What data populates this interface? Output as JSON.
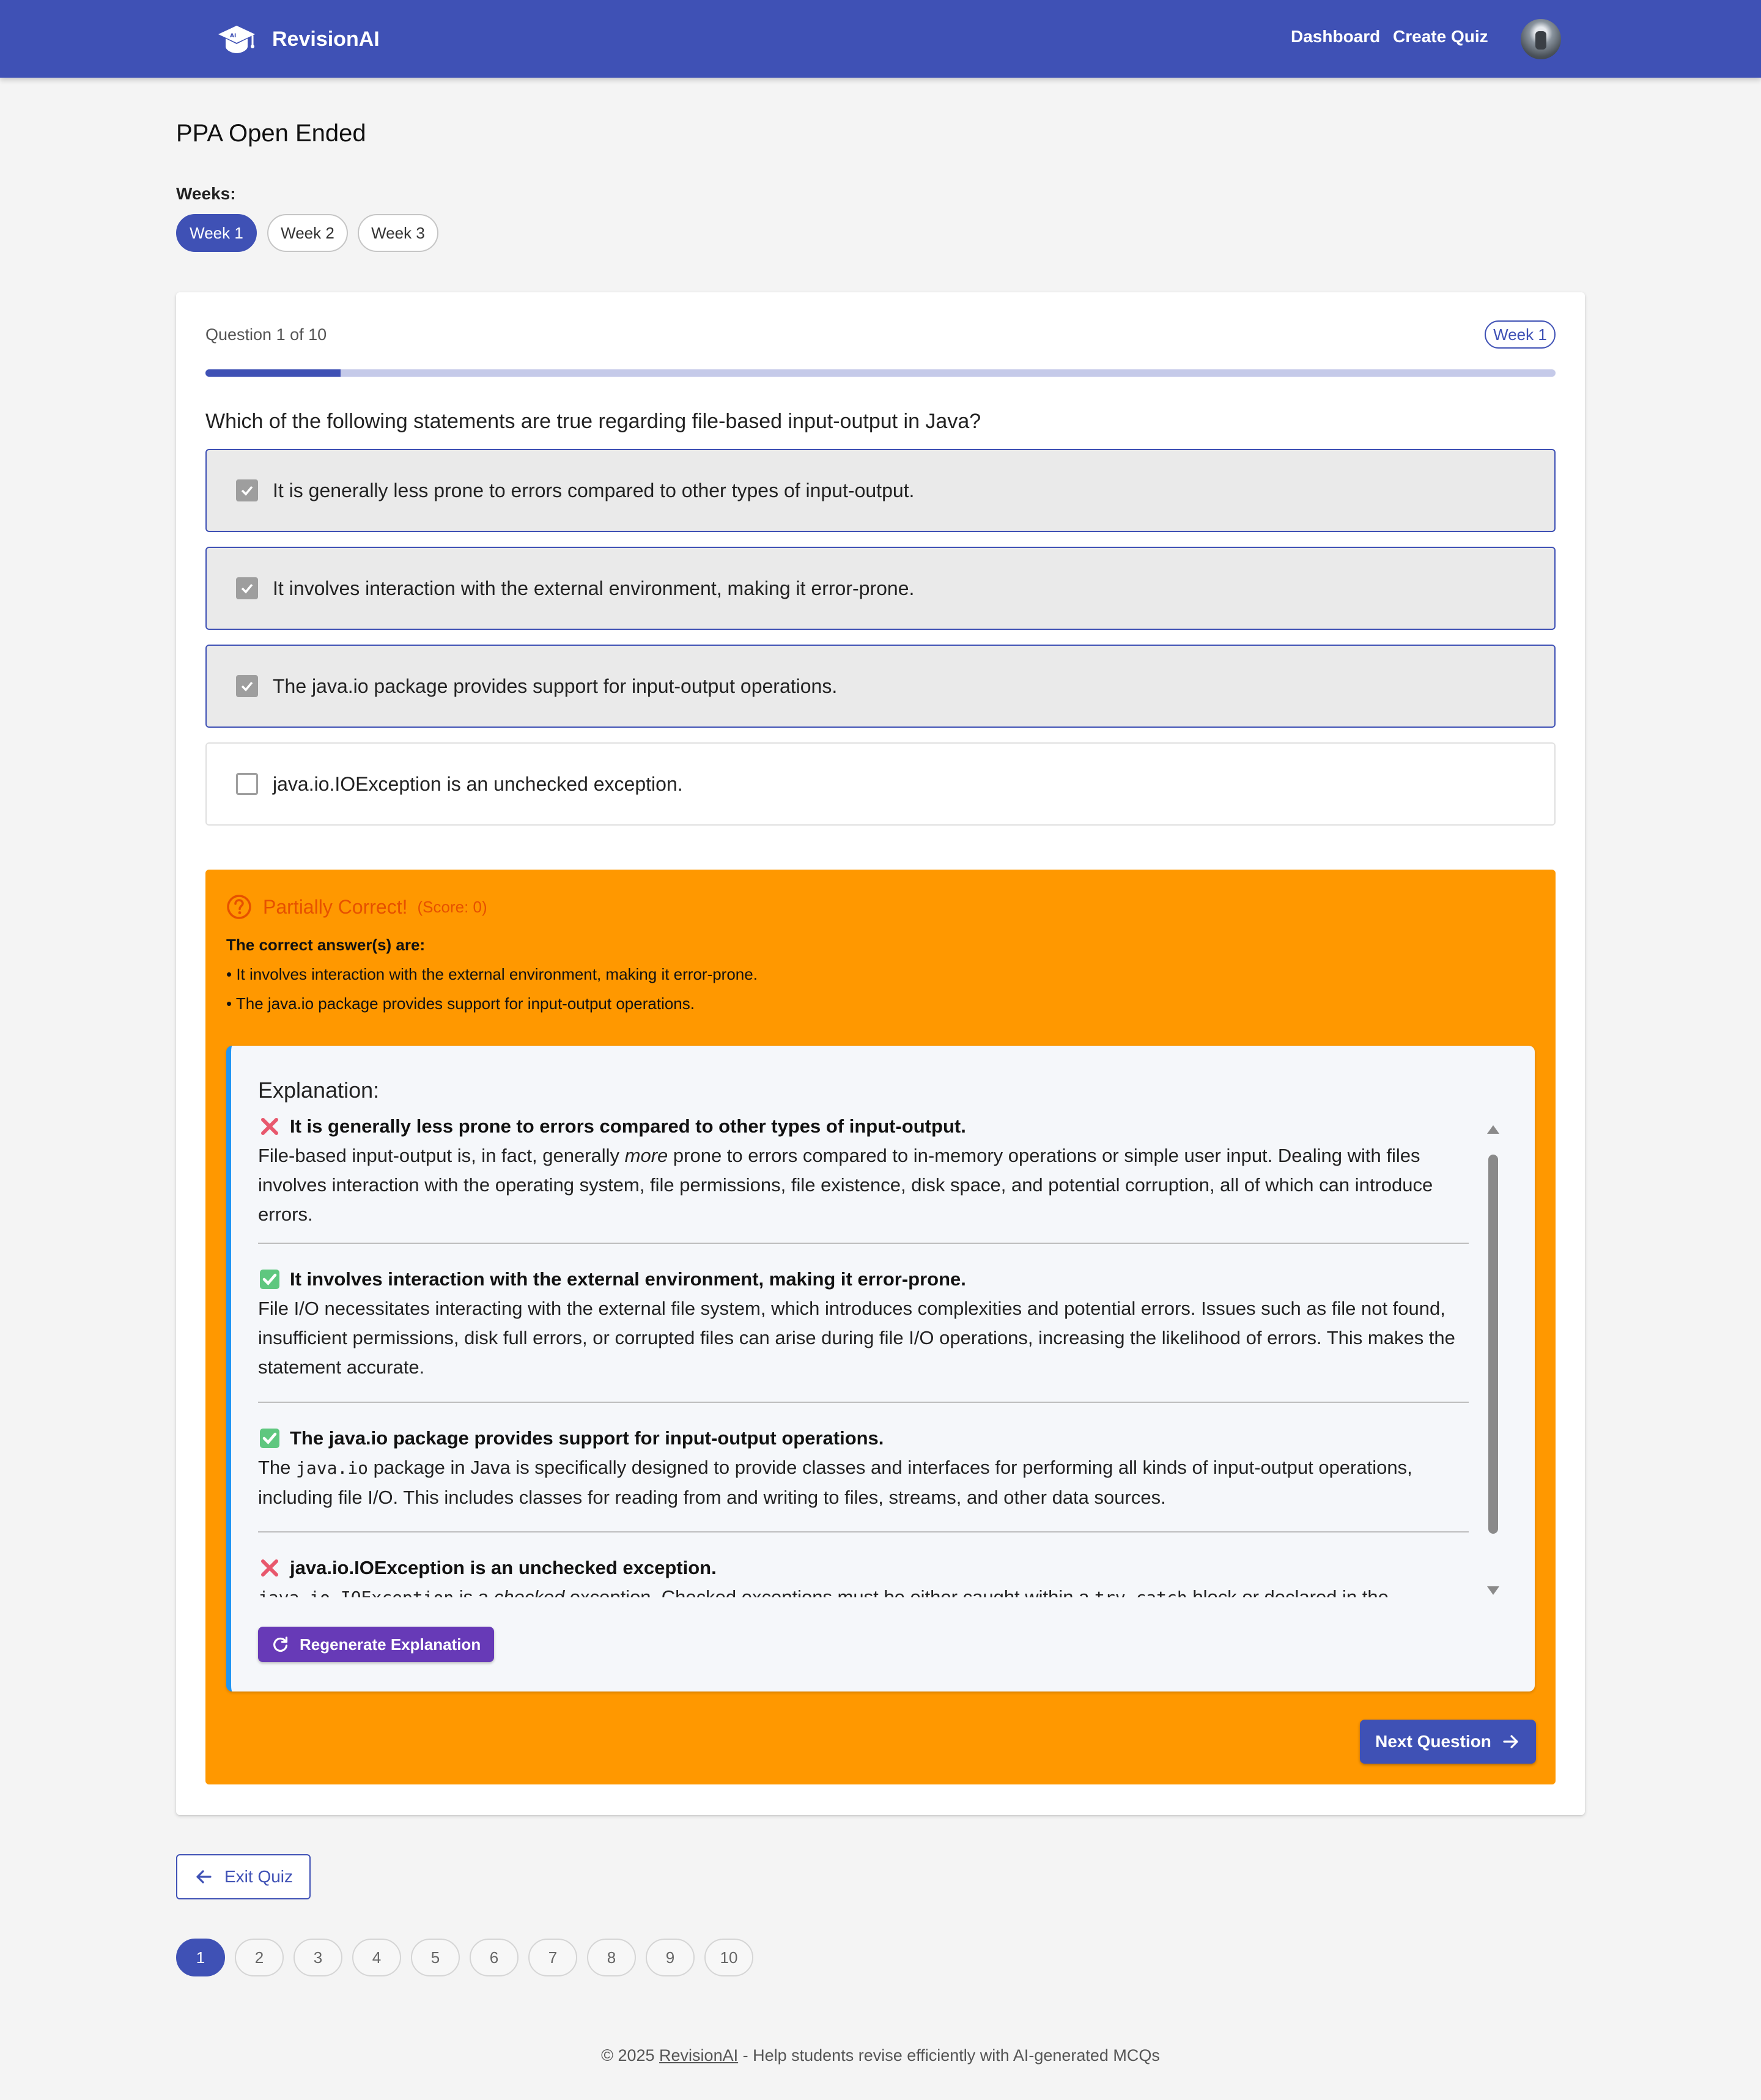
{
  "header": {
    "brand": "RevisionAI",
    "nav": [
      "Dashboard",
      "Create Quiz"
    ]
  },
  "page": {
    "title": "PPA Open Ended",
    "weeks_label": "Weeks:",
    "weeks": [
      "Week 1",
      "Week 2",
      "Week 3"
    ],
    "active_week": "Week 1"
  },
  "quiz": {
    "counter": "Question 1 of 10",
    "week_badge": "Week 1",
    "progress": 0.1,
    "question": "Which of the following statements are true regarding file-based input-output in Java?",
    "options": [
      {
        "label": "It is generally less prone to errors compared to other types of input-output.",
        "checked": true
      },
      {
        "label": "It involves interaction with the external environment, making it error-prone.",
        "checked": true
      },
      {
        "label": "The java.io package provides support for input-output operations.",
        "checked": true
      },
      {
        "label": "java.io.IOException is an unchecked exception.",
        "checked": false
      }
    ]
  },
  "feedback": {
    "title": "Partially Correct!",
    "score": "(Score: 0)",
    "correct_label": "The correct answer(s) are:",
    "answers": [
      "• It involves interaction with the external environment, making it error-prone.",
      "• The java.io package provides support for input-output operations."
    ],
    "explanation_title": "Explanation:",
    "explanations": [
      {
        "status": "wrong",
        "title": "It is generally less prone to errors compared to other types of input-output.",
        "pre": "File-based input-output is, in fact, generally ",
        "em": "more",
        "post": " prone to errors compared to in-memory operations or simple user input. Dealing with files involves interaction with the operating system, file permissions, file existence, disk space, and potential corruption, all of which can introduce errors."
      },
      {
        "status": "correct",
        "title": "It involves interaction with the external environment, making it error-prone.",
        "text": "File I/O necessitates interacting with the external file system, which introduces complexities and potential errors. Issues such as file not found, insufficient permissions, disk full errors, or corrupted files can arise during file I/O operations, increasing the likelihood of errors. This makes the statement accurate."
      },
      {
        "status": "correct",
        "title": "The java.io package provides support for input-output operations.",
        "pre": "The ",
        "code": "java.io",
        "post": " package in Java is specifically designed to provide classes and interfaces for performing all kinds of input-output operations, including file I/O. This includes classes for reading from and writing to files, streams, and other data sources."
      },
      {
        "status": "wrong",
        "title": "java.io.IOException is an unchecked exception.",
        "code1": "java.io.IOException",
        "mid1": " is a ",
        "em": "checked",
        "mid2": " exception. Checked exceptions must be either caught within a ",
        "code2": "try-catch",
        "post": " block or declared in the"
      }
    ],
    "regenerate_label": "Regenerate Explanation",
    "next_label": "Next Question"
  },
  "bottom": {
    "exit_label": "Exit Quiz",
    "pages": [
      "1",
      "2",
      "3",
      "4",
      "5",
      "6",
      "7",
      "8",
      "9",
      "10"
    ],
    "active_page": "1"
  },
  "footer": {
    "prefix": "© 2025 ",
    "link": "RevisionAI",
    "suffix": " - Help students revise efficiently with AI-generated MCQs"
  },
  "colors": {
    "primary": "#3f51b5",
    "feedback_bg": "#ff9800",
    "feedback_text": "#e65100",
    "regenerate": "#673ab7",
    "explanation_accent": "#2196f3"
  }
}
